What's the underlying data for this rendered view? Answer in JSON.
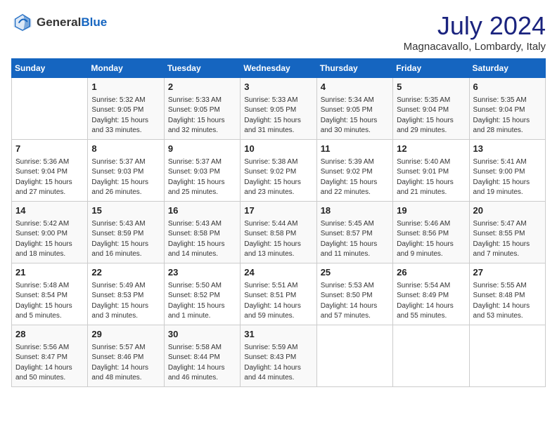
{
  "logo": {
    "general": "General",
    "blue": "Blue"
  },
  "title": {
    "month_year": "July 2024",
    "location": "Magnacavallo, Lombardy, Italy"
  },
  "headers": [
    "Sunday",
    "Monday",
    "Tuesday",
    "Wednesday",
    "Thursday",
    "Friday",
    "Saturday"
  ],
  "weeks": [
    [
      {
        "day": "",
        "info": ""
      },
      {
        "day": "1",
        "info": "Sunrise: 5:32 AM\nSunset: 9:05 PM\nDaylight: 15 hours\nand 33 minutes."
      },
      {
        "day": "2",
        "info": "Sunrise: 5:33 AM\nSunset: 9:05 PM\nDaylight: 15 hours\nand 32 minutes."
      },
      {
        "day": "3",
        "info": "Sunrise: 5:33 AM\nSunset: 9:05 PM\nDaylight: 15 hours\nand 31 minutes."
      },
      {
        "day": "4",
        "info": "Sunrise: 5:34 AM\nSunset: 9:05 PM\nDaylight: 15 hours\nand 30 minutes."
      },
      {
        "day": "5",
        "info": "Sunrise: 5:35 AM\nSunset: 9:04 PM\nDaylight: 15 hours\nand 29 minutes."
      },
      {
        "day": "6",
        "info": "Sunrise: 5:35 AM\nSunset: 9:04 PM\nDaylight: 15 hours\nand 28 minutes."
      }
    ],
    [
      {
        "day": "7",
        "info": "Sunrise: 5:36 AM\nSunset: 9:04 PM\nDaylight: 15 hours\nand 27 minutes."
      },
      {
        "day": "8",
        "info": "Sunrise: 5:37 AM\nSunset: 9:03 PM\nDaylight: 15 hours\nand 26 minutes."
      },
      {
        "day": "9",
        "info": "Sunrise: 5:37 AM\nSunset: 9:03 PM\nDaylight: 15 hours\nand 25 minutes."
      },
      {
        "day": "10",
        "info": "Sunrise: 5:38 AM\nSunset: 9:02 PM\nDaylight: 15 hours\nand 23 minutes."
      },
      {
        "day": "11",
        "info": "Sunrise: 5:39 AM\nSunset: 9:02 PM\nDaylight: 15 hours\nand 22 minutes."
      },
      {
        "day": "12",
        "info": "Sunrise: 5:40 AM\nSunset: 9:01 PM\nDaylight: 15 hours\nand 21 minutes."
      },
      {
        "day": "13",
        "info": "Sunrise: 5:41 AM\nSunset: 9:00 PM\nDaylight: 15 hours\nand 19 minutes."
      }
    ],
    [
      {
        "day": "14",
        "info": "Sunrise: 5:42 AM\nSunset: 9:00 PM\nDaylight: 15 hours\nand 18 minutes."
      },
      {
        "day": "15",
        "info": "Sunrise: 5:43 AM\nSunset: 8:59 PM\nDaylight: 15 hours\nand 16 minutes."
      },
      {
        "day": "16",
        "info": "Sunrise: 5:43 AM\nSunset: 8:58 PM\nDaylight: 15 hours\nand 14 minutes."
      },
      {
        "day": "17",
        "info": "Sunrise: 5:44 AM\nSunset: 8:58 PM\nDaylight: 15 hours\nand 13 minutes."
      },
      {
        "day": "18",
        "info": "Sunrise: 5:45 AM\nSunset: 8:57 PM\nDaylight: 15 hours\nand 11 minutes."
      },
      {
        "day": "19",
        "info": "Sunrise: 5:46 AM\nSunset: 8:56 PM\nDaylight: 15 hours\nand 9 minutes."
      },
      {
        "day": "20",
        "info": "Sunrise: 5:47 AM\nSunset: 8:55 PM\nDaylight: 15 hours\nand 7 minutes."
      }
    ],
    [
      {
        "day": "21",
        "info": "Sunrise: 5:48 AM\nSunset: 8:54 PM\nDaylight: 15 hours\nand 5 minutes."
      },
      {
        "day": "22",
        "info": "Sunrise: 5:49 AM\nSunset: 8:53 PM\nDaylight: 15 hours\nand 3 minutes."
      },
      {
        "day": "23",
        "info": "Sunrise: 5:50 AM\nSunset: 8:52 PM\nDaylight: 15 hours\nand 1 minute."
      },
      {
        "day": "24",
        "info": "Sunrise: 5:51 AM\nSunset: 8:51 PM\nDaylight: 14 hours\nand 59 minutes."
      },
      {
        "day": "25",
        "info": "Sunrise: 5:53 AM\nSunset: 8:50 PM\nDaylight: 14 hours\nand 57 minutes."
      },
      {
        "day": "26",
        "info": "Sunrise: 5:54 AM\nSunset: 8:49 PM\nDaylight: 14 hours\nand 55 minutes."
      },
      {
        "day": "27",
        "info": "Sunrise: 5:55 AM\nSunset: 8:48 PM\nDaylight: 14 hours\nand 53 minutes."
      }
    ],
    [
      {
        "day": "28",
        "info": "Sunrise: 5:56 AM\nSunset: 8:47 PM\nDaylight: 14 hours\nand 50 minutes."
      },
      {
        "day": "29",
        "info": "Sunrise: 5:57 AM\nSunset: 8:46 PM\nDaylight: 14 hours\nand 48 minutes."
      },
      {
        "day": "30",
        "info": "Sunrise: 5:58 AM\nSunset: 8:44 PM\nDaylight: 14 hours\nand 46 minutes."
      },
      {
        "day": "31",
        "info": "Sunrise: 5:59 AM\nSunset: 8:43 PM\nDaylight: 14 hours\nand 44 minutes."
      },
      {
        "day": "",
        "info": ""
      },
      {
        "day": "",
        "info": ""
      },
      {
        "day": "",
        "info": ""
      }
    ]
  ]
}
